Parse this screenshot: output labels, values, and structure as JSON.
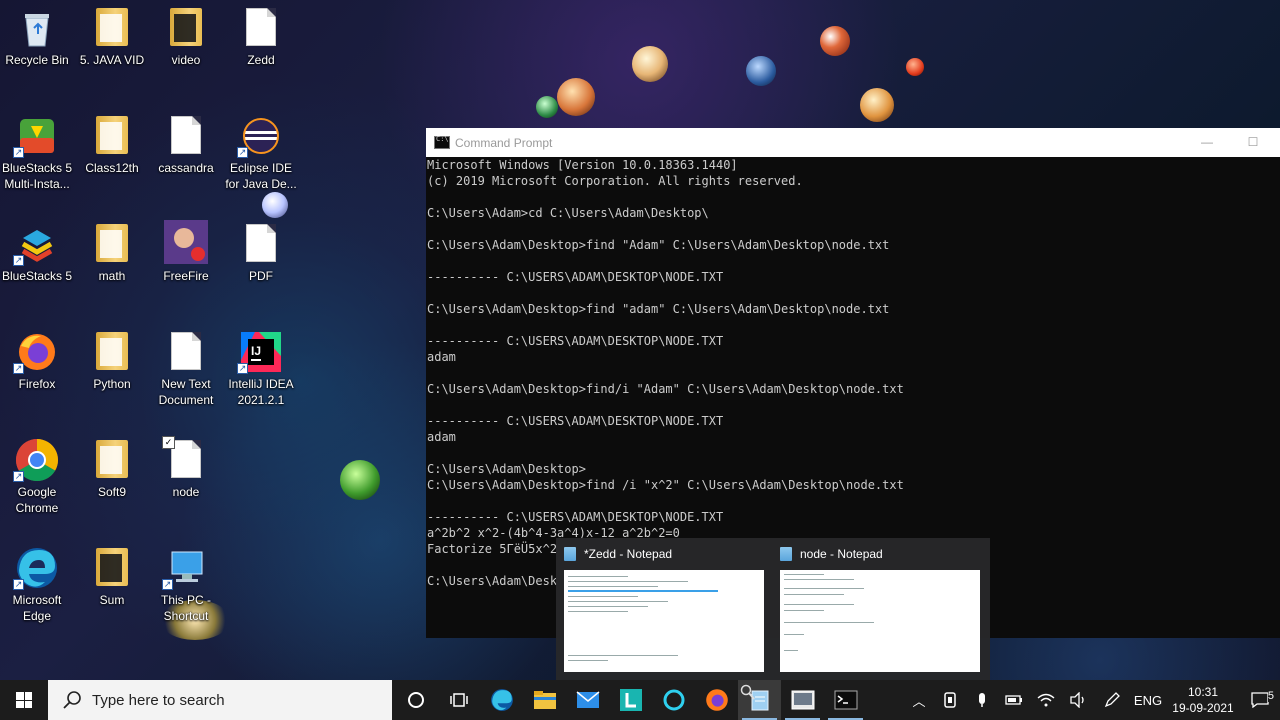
{
  "desktop": {
    "icons": [
      {
        "label": "Recycle Bin",
        "icon": "recycle-bin-icon"
      },
      {
        "label": "5. JAVA VID",
        "icon": "folder-icon"
      },
      {
        "label": "video",
        "icon": "folder-icon"
      },
      {
        "label": "Zedd",
        "icon": "text-document-icon"
      },
      {
        "label": "BlueStacks 5 Multi-Insta...",
        "icon": "bluestacks-multi-instance-icon"
      },
      {
        "label": "Class12th",
        "icon": "folder-icon"
      },
      {
        "label": "cassandra",
        "icon": "text-document-icon"
      },
      {
        "label": "Eclipse IDE for Java De...",
        "icon": "eclipse-icon"
      },
      {
        "label": "BlueStacks 5",
        "icon": "bluestacks-icon"
      },
      {
        "label": "math",
        "icon": "folder-icon"
      },
      {
        "label": "FreeFire",
        "icon": "freefire-icon"
      },
      {
        "label": "PDF",
        "icon": "text-document-icon"
      },
      {
        "label": "Firefox",
        "icon": "firefox-icon"
      },
      {
        "label": "Python",
        "icon": "folder-icon"
      },
      {
        "label": "New Text Document",
        "icon": "text-document-icon"
      },
      {
        "label": "IntelliJ IDEA 2021.2.1",
        "icon": "intellij-idea-icon"
      },
      {
        "label": "Google Chrome",
        "icon": "chrome-icon"
      },
      {
        "label": "Soft9",
        "icon": "folder-icon"
      },
      {
        "label": "node",
        "icon": "text-document-icon"
      },
      {
        "label": "Microsoft Edge",
        "icon": "edge-icon"
      },
      {
        "label": "Sum",
        "icon": "folder-icon"
      },
      {
        "label": "This PC - Shortcut",
        "icon": "this-pc-icon"
      }
    ]
  },
  "cmd": {
    "title": "Command Prompt",
    "lines": [
      "Microsoft Windows [Version 10.0.18363.1440]",
      "(c) 2019 Microsoft Corporation. All rights reserved.",
      "",
      "C:\\Users\\Adam>cd C:\\Users\\Adam\\Desktop\\",
      "",
      "C:\\Users\\Adam\\Desktop>find \"Adam\" C:\\Users\\Adam\\Desktop\\node.txt",
      "",
      "---------- C:\\USERS\\ADAM\\DESKTOP\\NODE.TXT",
      "",
      "C:\\Users\\Adam\\Desktop>find \"adam\" C:\\Users\\Adam\\Desktop\\node.txt",
      "",
      "---------- C:\\USERS\\ADAM\\DESKTOP\\NODE.TXT",
      "adam",
      "",
      "C:\\Users\\Adam\\Desktop>find/i \"Adam\" C:\\Users\\Adam\\Desktop\\node.txt",
      "",
      "---------- C:\\USERS\\ADAM\\DESKTOP\\NODE.TXT",
      "adam",
      "",
      "C:\\Users\\Adam\\Desktop>",
      "C:\\Users\\Adam\\Desktop>find /i \"x^2\" C:\\Users\\Adam\\Desktop\\node.txt",
      "",
      "---------- C:\\USERS\\ADAM\\DESKTOP\\NODE.TXT",
      "a^2b^2 x^2-(4b^4-3a^4)x-12 a^2b^2=0",
      "Factorize 5ΓëÜ5x^2",
      "",
      "C:\\Users\\Adam\\Desk"
    ]
  },
  "preview": {
    "windows": [
      {
        "title": "*Zedd - Notepad"
      },
      {
        "title": "node - Notepad"
      }
    ]
  },
  "taskbar": {
    "search_placeholder": "Type here to search",
    "language": "ENG",
    "time": "10:31",
    "date": "19-09-2021",
    "notification_count": "5"
  }
}
